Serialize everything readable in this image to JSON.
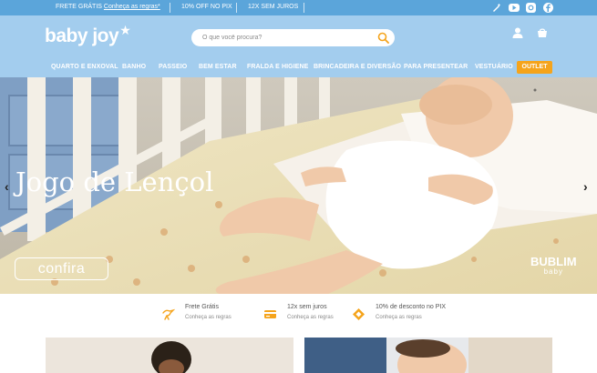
{
  "topbar": {
    "msg1_prefix": "FRETE GRÁTIS",
    "msg1_link": "Conheça as regras*",
    "msg2": "10% OFF NO PIX",
    "msg3": "12X SEM JUROS",
    "social_icons": [
      "blog-icon",
      "youtube-icon",
      "instagram-icon",
      "facebook-icon"
    ]
  },
  "header": {
    "logo_text": "baby joy",
    "search_placeholder": "O que você procura?"
  },
  "nav": {
    "items": [
      "QUARTO E ENXOVAL",
      "BANHO",
      "PASSEIO",
      "BEM ESTAR",
      "FRALDA E HIGIENE",
      "BRINCADEIRA E DIVERSÃO",
      "PARA PRESENTEAR",
      "VESTUÁRIO"
    ],
    "outlet": "OUTLET"
  },
  "hero": {
    "title": "Jogo de Lençol",
    "button": "confira",
    "brand_main": "BUBLIM",
    "brand_sub": "baby"
  },
  "benefits": [
    {
      "title": "Frete Grátis",
      "subtitle": "Conheça as regras",
      "icon": "stork-icon"
    },
    {
      "title": "12x sem juros",
      "subtitle": "Conheça as regras",
      "icon": "credit-card-icon"
    },
    {
      "title": "10% de desconto no PIX",
      "subtitle": "Conheça as regras",
      "icon": "pix-icon"
    }
  ],
  "colors": {
    "topbar": "#5ba5da",
    "header": "#a3cdee",
    "outlet": "#f5a41c",
    "icon_accent": "#f5a41c"
  }
}
